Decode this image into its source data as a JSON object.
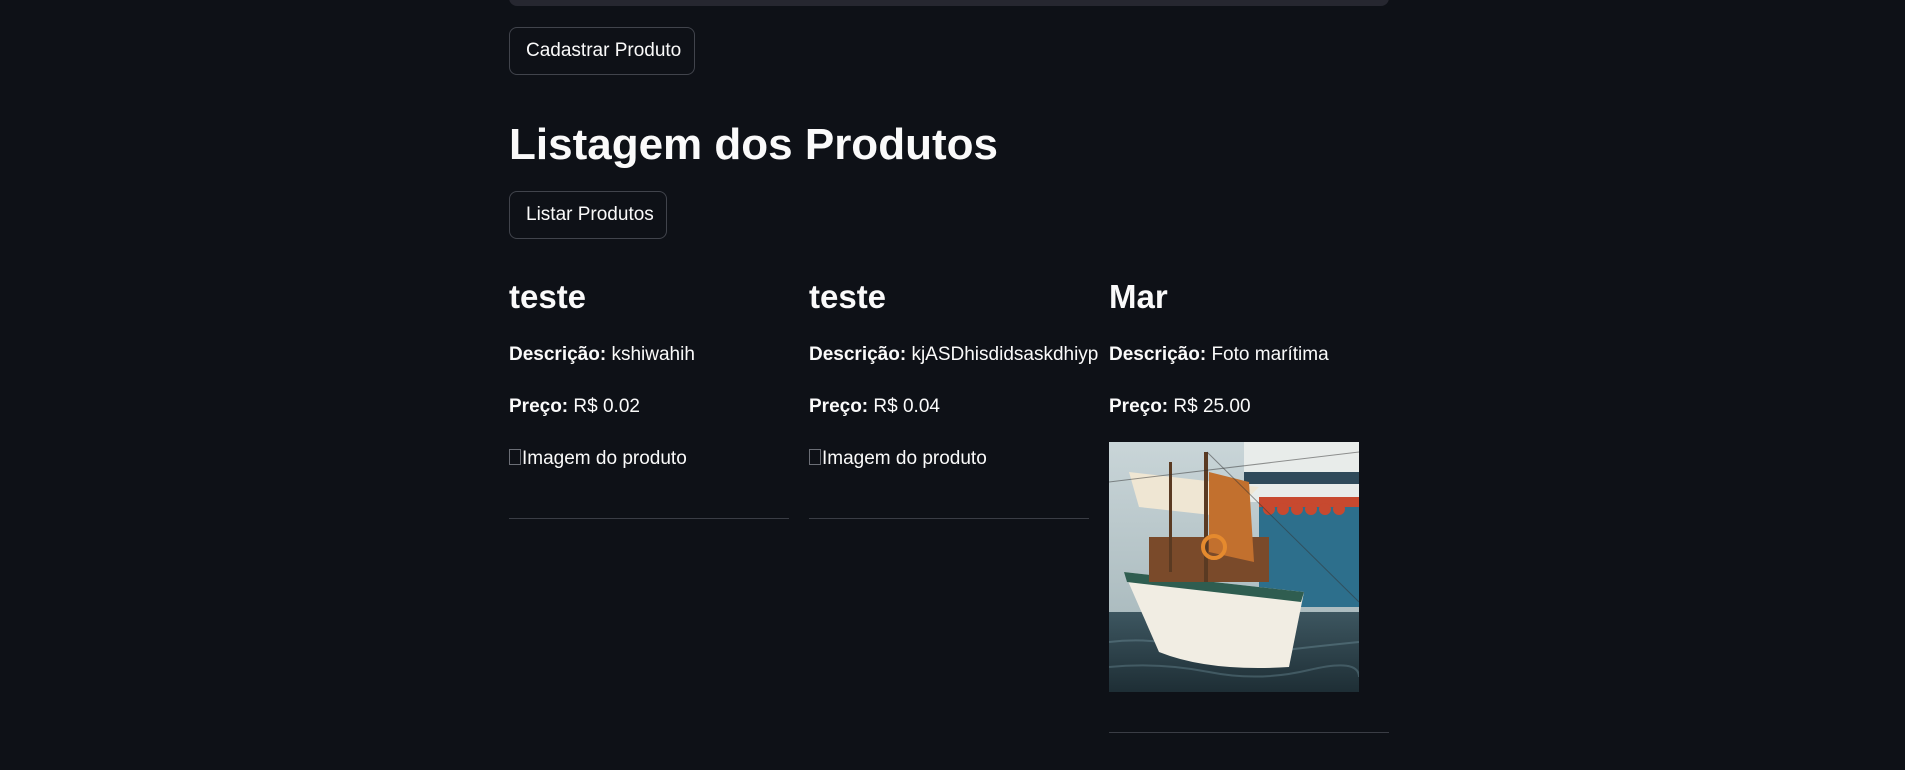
{
  "form": {
    "submit_label": "Cadastrar Produto"
  },
  "listing": {
    "title": "Listagem dos Produtos",
    "list_button_label": "Listar Produtos"
  },
  "labels": {
    "description": "Descrição:",
    "price": "Preço:"
  },
  "products": [
    {
      "name": "teste",
      "description": "kshiwahih",
      "price": "R$ 0.02",
      "image_alt": "Imagem do produto"
    },
    {
      "name": "teste",
      "description": "kjASDhisdidsaskdhiyp",
      "price": "R$ 0.04",
      "image_alt": "Imagem do produto"
    },
    {
      "name": "Mar",
      "description": "Foto marítima",
      "price": "R$ 25.00",
      "image_alt": "Imagem do produto"
    }
  ],
  "colors": {
    "background": "#0e1117",
    "text": "#fafafa",
    "button_border": "#41444c",
    "divider": "#3a3d45"
  }
}
